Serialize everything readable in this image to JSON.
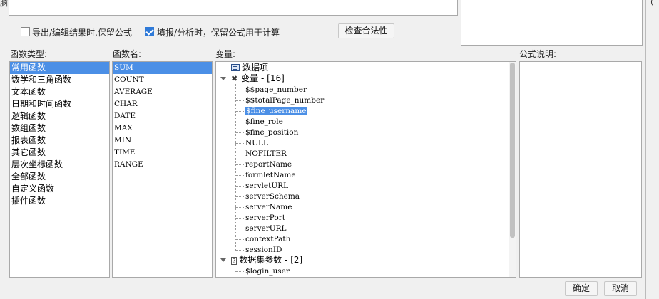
{
  "options": {
    "export_keep_formula": "导出/编辑结果时,保留公式",
    "export_keep_formula_checked": false,
    "fill_keep_formula": "填报/分析时，保留公式用于计算",
    "fill_keep_formula_checked": true,
    "check_validity": "检查合法性"
  },
  "panels": {
    "func_type_label": "函数类型:",
    "func_name_label": "函数名:",
    "variable_label": "变量:",
    "description_label": "公式说明:"
  },
  "func_types": [
    "常用函数",
    "数学和三角函数",
    "文本函数",
    "日期和时间函数",
    "逻辑函数",
    "数组函数",
    "报表函数",
    "其它函数",
    "层次坐标函数",
    "全部函数",
    "自定义函数",
    "插件函数"
  ],
  "func_types_selected": 0,
  "func_names": [
    "SUM",
    "COUNT",
    "AVERAGE",
    "CHAR",
    "DATE",
    "MAX",
    "MIN",
    "TIME",
    "RANGE"
  ],
  "func_names_selected": 0,
  "tree": {
    "data_item": "数据项",
    "variables_group": "变量 - [16]",
    "variables": [
      "$$page_number",
      "$$totalPage_number",
      "$fine_username",
      "$fine_role",
      "$fine_position",
      "NULL",
      "NOFILTER",
      "reportName",
      "formletName",
      "servletURL",
      "serverSchema",
      "serverName",
      "serverPort",
      "serverURL",
      "contextPath",
      "sessionID"
    ],
    "variables_selected": 2,
    "dataset_group": "数据集参数 - [2]",
    "dataset_params": [
      "$login_user"
    ]
  },
  "footer": {
    "ok": "确定",
    "cancel": "取消"
  },
  "top_right_glyph": "(",
  "top_left_glyph": "脑"
}
